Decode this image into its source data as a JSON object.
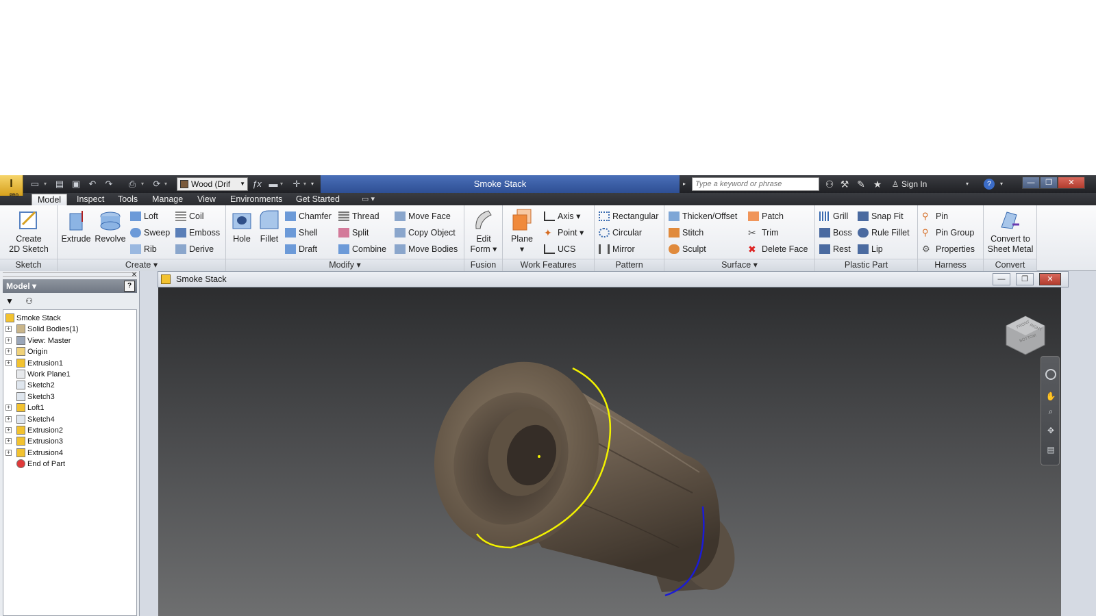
{
  "window": {
    "title": "Smoke Stack",
    "material": "Wood (Drif",
    "search_placeholder": "Type a keyword or phrase",
    "sign_in": "Sign In",
    "app_badge": "PRO"
  },
  "tabs": [
    "Model",
    "Inspect",
    "Tools",
    "Manage",
    "View",
    "Environments",
    "Get Started"
  ],
  "ribbon": {
    "sketch": {
      "label": "Sketch",
      "create_2d_sketch": "Create\n2D Sketch"
    },
    "create": {
      "label": "Create",
      "extrude": "Extrude",
      "revolve": "Revolve",
      "loft": "Loft",
      "sweep": "Sweep",
      "rib": "Rib",
      "coil": "Coil",
      "emboss": "Emboss",
      "derive": "Derive"
    },
    "modify": {
      "label": "Modify",
      "hole": "Hole",
      "fillet": "Fillet",
      "chamfer": "Chamfer",
      "shell": "Shell",
      "draft": "Draft",
      "thread": "Thread",
      "split": "Split",
      "combine": "Combine",
      "move_face": "Move Face",
      "copy_object": "Copy Object",
      "move_bodies": "Move Bodies"
    },
    "fusion": {
      "label": "Fusion",
      "edit_form_1": "Edit",
      "edit_form_2": "Form"
    },
    "work_features": {
      "label": "Work Features",
      "plane": "Plane",
      "axis": "Axis",
      "point": "Point",
      "ucs": "UCS"
    },
    "pattern": {
      "label": "Pattern",
      "rectangular": "Rectangular",
      "circular": "Circular",
      "mirror": "Mirror"
    },
    "surface": {
      "label": "Surface",
      "thicken_offset": "Thicken/Offset",
      "stitch": "Stitch",
      "sculpt": "Sculpt",
      "patch": "Patch",
      "trim": "Trim",
      "delete_face": "Delete Face"
    },
    "plastic_part": {
      "label": "Plastic Part",
      "grill": "Grill",
      "boss": "Boss",
      "rest": "Rest",
      "snap_fit": "Snap Fit",
      "rule_fillet": "Rule Fillet",
      "lip": "Lip"
    },
    "harness": {
      "label": "Harness",
      "pin": "Pin",
      "pin_group": "Pin Group",
      "properties": "Properties"
    },
    "convert": {
      "label": "Convert",
      "convert_1": "Convert to",
      "convert_2": "Sheet Metal"
    }
  },
  "browser": {
    "header": "Model",
    "tree": [
      {
        "label": "Smoke Stack",
        "icon": "part-icon",
        "expand": false,
        "root": true
      },
      {
        "label": "Solid Bodies(1)",
        "icon": "solid-bodies-icon",
        "expand": true
      },
      {
        "label": "View: Master",
        "icon": "view-icon",
        "expand": true
      },
      {
        "label": "Origin",
        "icon": "folder-icon",
        "expand": true
      },
      {
        "label": "Extrusion1",
        "icon": "extrusion-icon",
        "expand": true
      },
      {
        "label": "Work Plane1",
        "icon": "work-plane-icon",
        "expand": false
      },
      {
        "label": "Sketch2",
        "icon": "sketch-icon",
        "expand": false
      },
      {
        "label": "Sketch3",
        "icon": "sketch-icon",
        "expand": false
      },
      {
        "label": "Loft1",
        "icon": "loft-icon",
        "expand": true
      },
      {
        "label": "Sketch4",
        "icon": "sketch-icon",
        "expand": true
      },
      {
        "label": "Extrusion2",
        "icon": "extrusion-icon",
        "expand": true
      },
      {
        "label": "Extrusion3",
        "icon": "extrusion-icon",
        "expand": true
      },
      {
        "label": "Extrusion4",
        "icon": "extrusion-icon",
        "expand": true
      },
      {
        "label": "End of Part",
        "icon": "end-of-part-icon",
        "expand": false
      }
    ]
  },
  "document": {
    "title": "Smoke Stack"
  },
  "viewcube": {
    "front": "FRONT",
    "right": "RIGHT",
    "bottom": "BOTTOM"
  },
  "colors": {
    "title_accent": "#3a5ea8",
    "selection_yellow": "#f2f200",
    "selection_blue": "#1b1bd6",
    "wood": "#6f5f4e"
  }
}
